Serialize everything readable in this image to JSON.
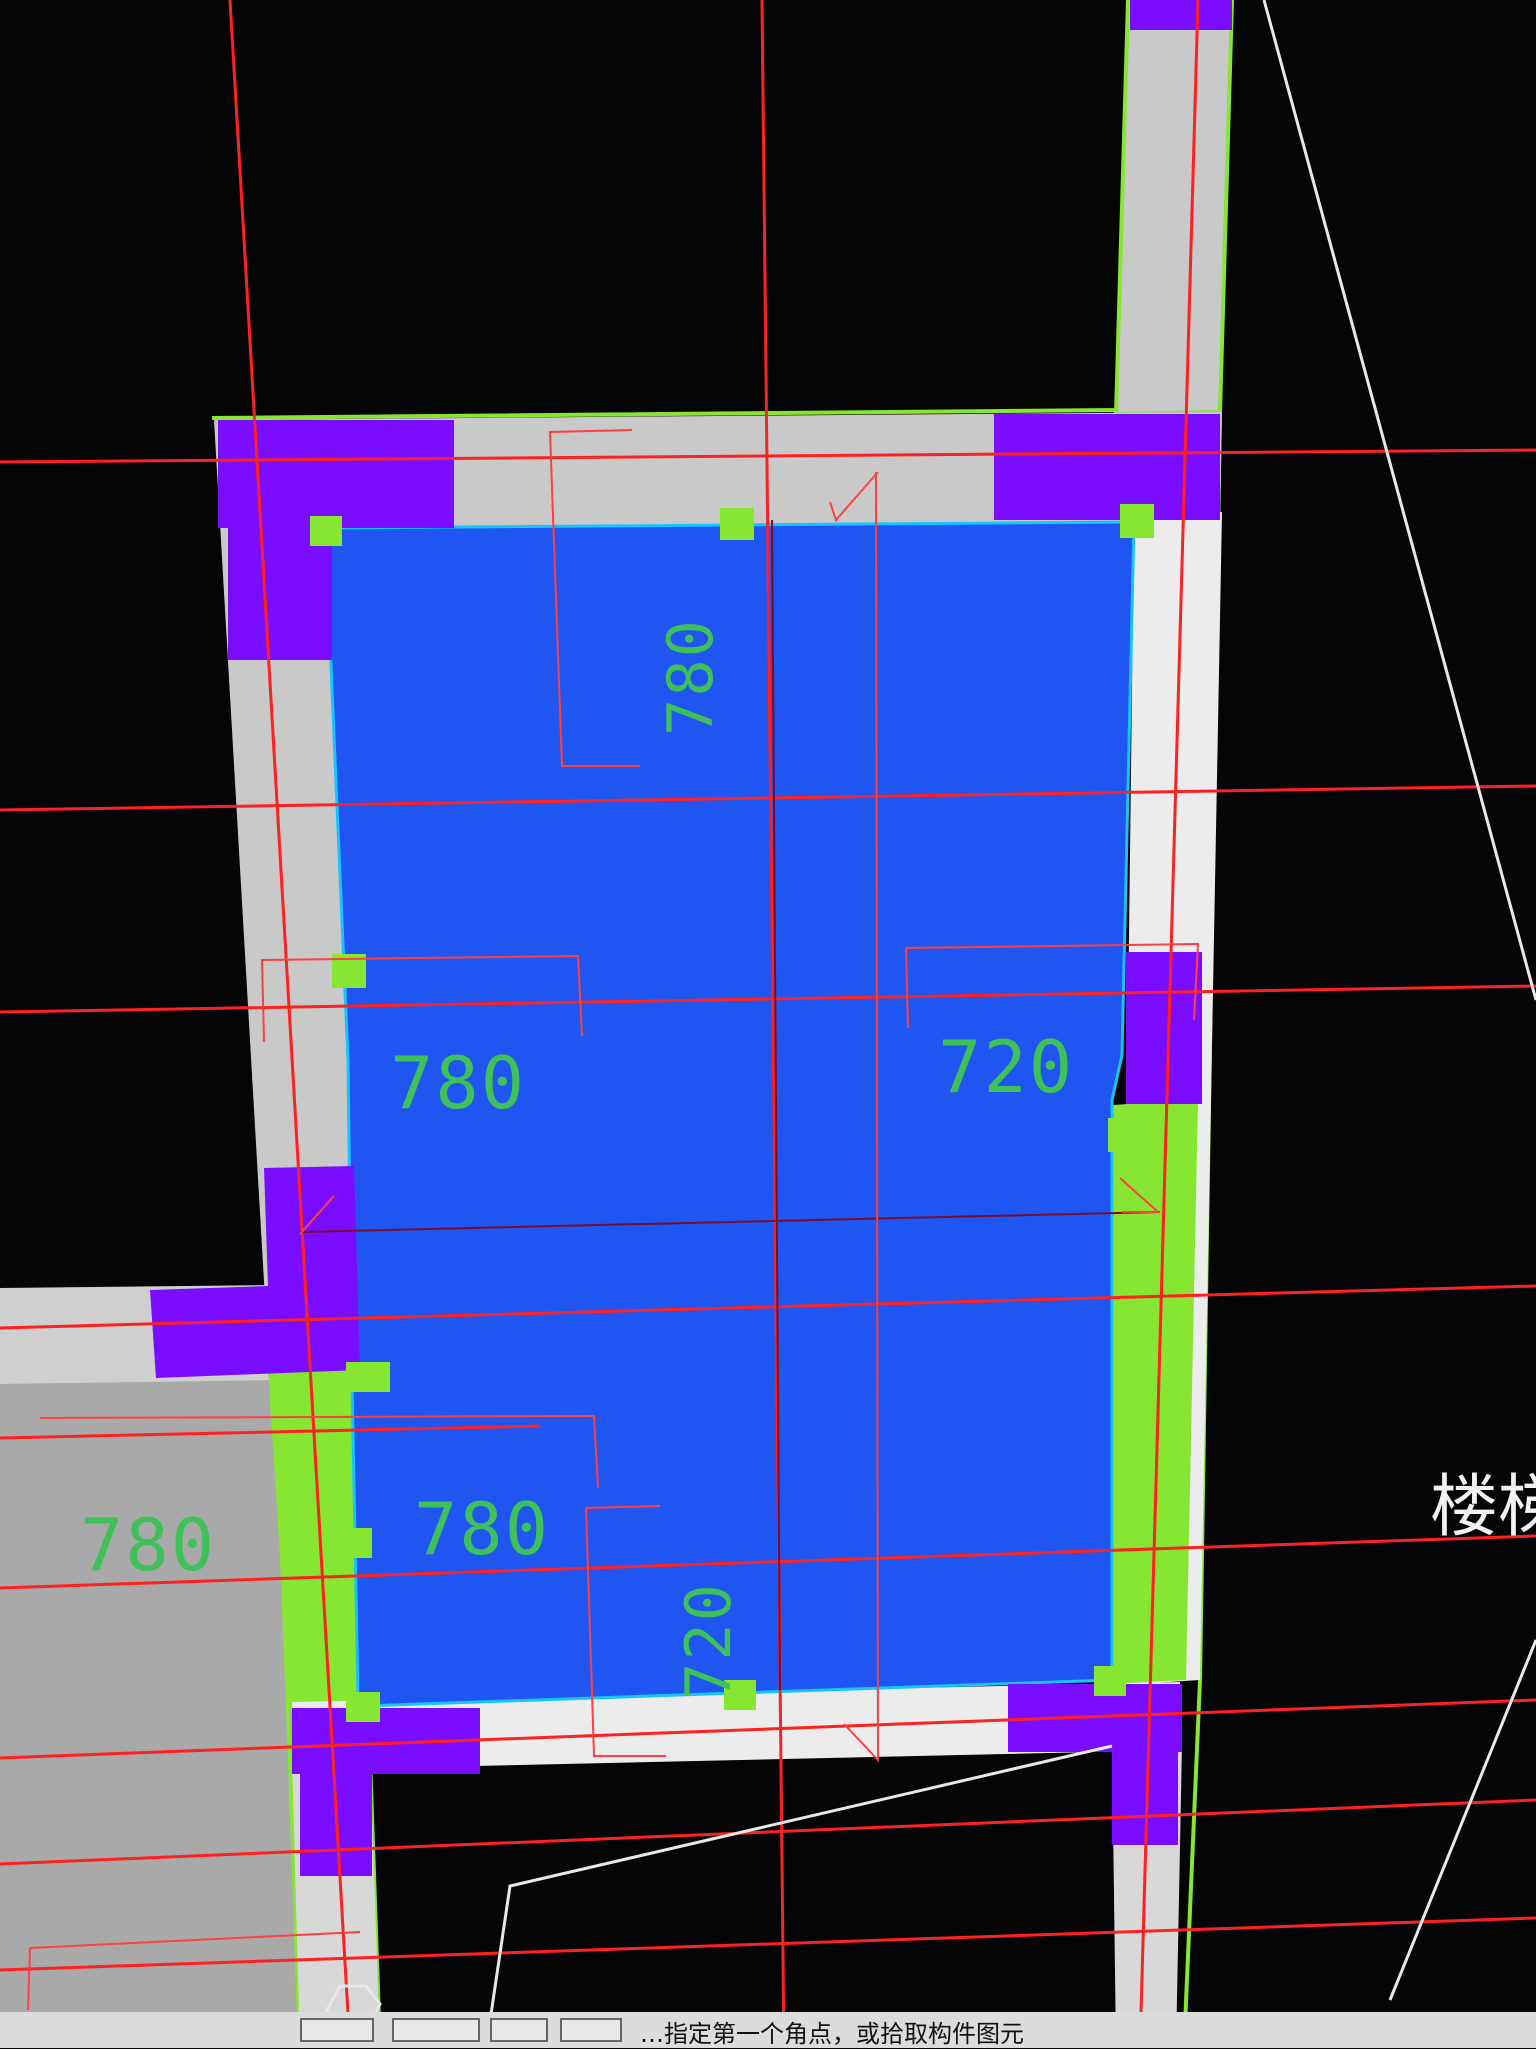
{
  "drawing": {
    "dimensions": {
      "top_vertical": "780",
      "left_middle": "780",
      "right_middle": "720",
      "bottom_left": "780",
      "bottom_vertical": "720",
      "outside_left": "780"
    },
    "room_label": "楼梯",
    "colors": {
      "background": "#050505",
      "slab_fill": "#1f55f0",
      "wall": "#c9c9c9",
      "column": "#7a0cff",
      "wall_selected": "#86e632",
      "axis_line": "#ff2020",
      "dimension_line": "#ff4040",
      "dimension_text": "#3fc15a"
    }
  },
  "statusbar": {
    "hint": "…指定第一个角点，或拾取构件图元"
  }
}
